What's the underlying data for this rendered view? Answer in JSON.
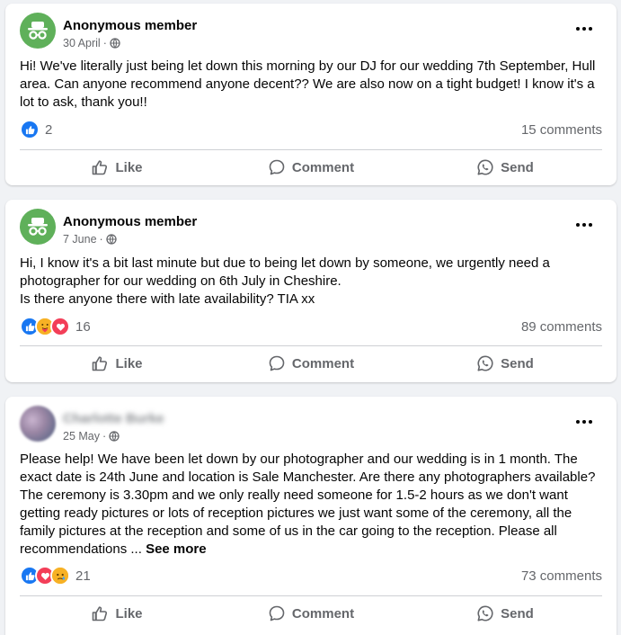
{
  "actions": {
    "like": "Like",
    "comment": "Comment",
    "send": "Send"
  },
  "posts": [
    {
      "author": "Anonymous member",
      "date": "30 April",
      "audience": "globe-icon",
      "text": "Hi! We've literally just being let down this morning by our DJ for our wedding 7th September, Hull area. Can anyone recommend anyone decent??  We are also now on a tight budget! I know it's a lot to ask, thank you!!",
      "reactions": [
        "like"
      ],
      "reaction_count": "2",
      "comments": "15 comments"
    },
    {
      "author": "Anonymous member",
      "date": "7 June",
      "audience": "globe-icon",
      "text_lines": [
        "Hi, I know it's a bit last minute but due to being let down by someone, we urgently need a photographer for our wedding on 6th July in Cheshire.",
        "Is there anyone there with late availability? TIA xx"
      ],
      "reactions": [
        "like",
        "care",
        "love"
      ],
      "reaction_count": "16",
      "comments": "89 comments"
    },
    {
      "author": "Charlotte Burke",
      "author_blurred": true,
      "date": "25 May",
      "audience": "globe-icon",
      "text": "Please help! We have been let down by our photographer and our wedding is in 1 month. The exact date is 24th June and location is Sale Manchester. Are there any photographers available? The ceremony is 3.30pm and we only really need someone for 1.5-2 hours as we don't want getting ready pictures or lots of reception pictures we just want some of the ceremony, all the family pictures at the reception and some of us in the car going to the reception. Please all recommendations ...",
      "see_more": "See more",
      "reactions": [
        "like",
        "love",
        "sad"
      ],
      "reaction_count": "21",
      "comments": "73 comments"
    }
  ],
  "colors": {
    "brand": "#1877f2",
    "love": "#f33e58",
    "muted": "#65676b",
    "bg": "#f0f2f5"
  }
}
